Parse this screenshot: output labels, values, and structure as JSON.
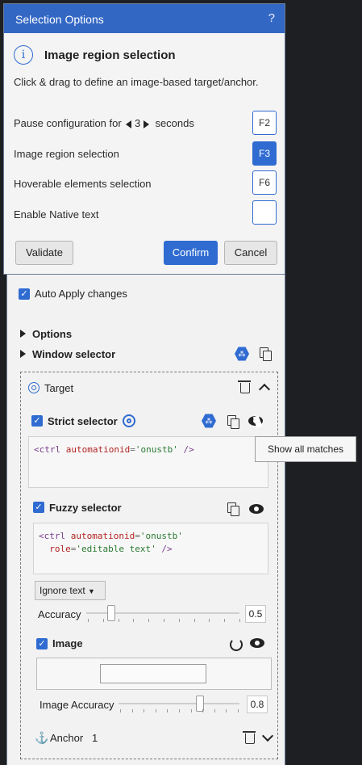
{
  "dialog": {
    "title": "Selection Options",
    "help": "?",
    "heading": "Image region selection",
    "description": "Click & drag to define an image-based target/anchor.",
    "pause": {
      "prefix": "Pause configuration for",
      "value": "3",
      "suffix": "seconds",
      "key": "F2"
    },
    "image_region": {
      "label": "Image region selection",
      "key": "F3"
    },
    "hoverable": {
      "label": "Hoverable elements selection",
      "key": "F6"
    },
    "native_text": {
      "label": "Enable Native text"
    },
    "buttons": {
      "validate": "Validate",
      "confirm": "Confirm",
      "cancel": "Cancel"
    }
  },
  "panel": {
    "auto_apply": "Auto Apply changes",
    "options": "Options",
    "window_selector": "Window selector",
    "target": {
      "label": "Target",
      "strict": {
        "label": "Strict selector",
        "code_tag": "<ctrl",
        "code_attr": "automationid",
        "code_val": "'onustb'",
        "code_end": "/>"
      },
      "fuzzy": {
        "label": "Fuzzy selector",
        "line1_tag": "<ctrl",
        "line1_attr": "automationid",
        "line1_val": "'onustb'",
        "line2_attr": "role",
        "line2_val": "'editable text'",
        "line2_end": "/>",
        "dropdown": "Ignore text",
        "accuracy_label": "Accuracy",
        "accuracy_value": "0.5"
      },
      "image": {
        "label": "Image",
        "accuracy_label": "Image Accuracy",
        "accuracy_value": "0.8"
      }
    },
    "anchor": {
      "label": "Anchor",
      "count": "1"
    }
  },
  "tooltip": "Show all matches",
  "colors": {
    "accent": "#2f6bd1",
    "titlebar": "#3367c4"
  }
}
